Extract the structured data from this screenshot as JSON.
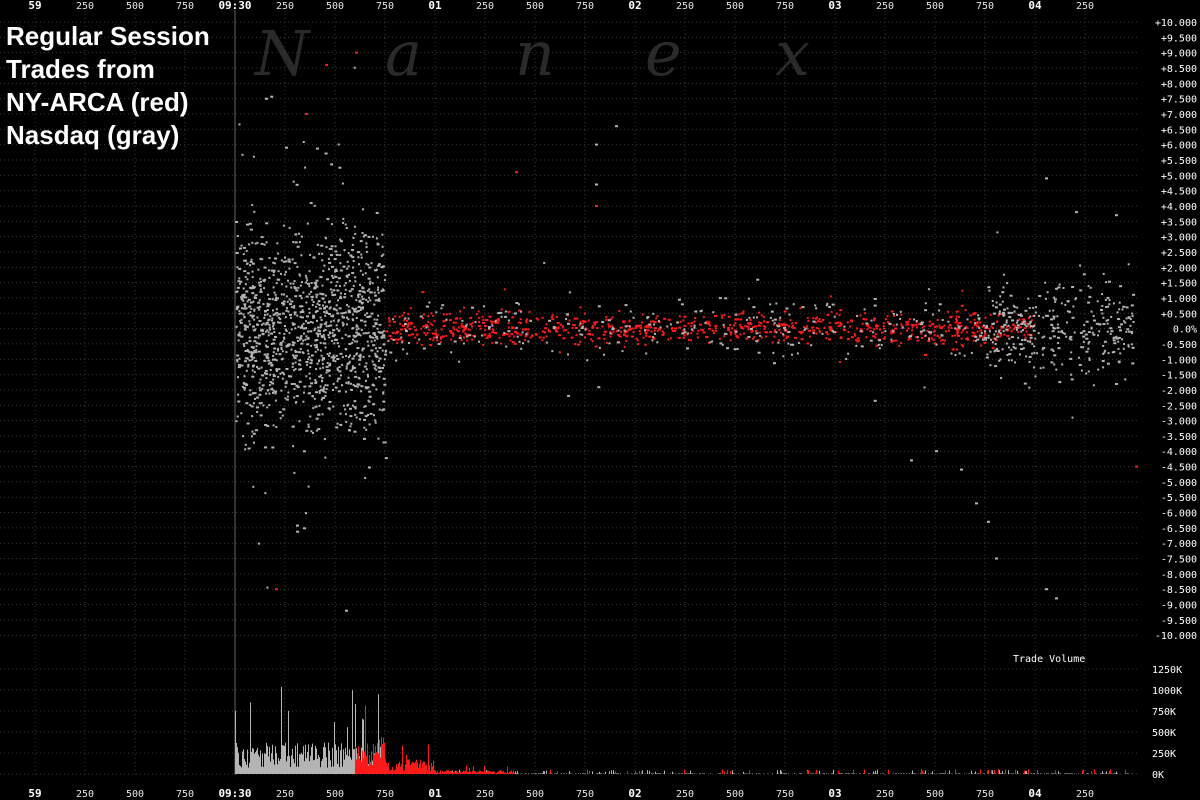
{
  "caption": {
    "lines": [
      "Regular Session",
      "Trades from",
      "NY-ARCA (red)",
      "Nasdaq (gray)"
    ]
  },
  "watermark": [
    "N",
    "a",
    "n",
    "e",
    "x"
  ],
  "volume_label": "Trade Volume",
  "colors": {
    "background": "#000000",
    "nyarca": "#ff1a1a",
    "nasdaq": "#b4b4b4",
    "grid": "#3a3a3a",
    "text": "#ffffff"
  },
  "chart_data": [
    {
      "type": "scatter",
      "title": "",
      "xlabel": "",
      "ylabel": "",
      "x_ticks": [
        {
          "label": "59",
          "major": true
        },
        {
          "label": "250",
          "major": false
        },
        {
          "label": "500",
          "major": false
        },
        {
          "label": "750",
          "major": false
        },
        {
          "label": "09:30",
          "major": true
        },
        {
          "label": "250",
          "major": false
        },
        {
          "label": "500",
          "major": false
        },
        {
          "label": "750",
          "major": false
        },
        {
          "label": "01",
          "major": true
        },
        {
          "label": "250",
          "major": false
        },
        {
          "label": "500",
          "major": false
        },
        {
          "label": "750",
          "major": false
        },
        {
          "label": "02",
          "major": true
        },
        {
          "label": "250",
          "major": false
        },
        {
          "label": "500",
          "major": false
        },
        {
          "label": "750",
          "major": false
        },
        {
          "label": "03",
          "major": true
        },
        {
          "label": "250",
          "major": false
        },
        {
          "label": "500",
          "major": false
        },
        {
          "label": "750",
          "major": false
        },
        {
          "label": "04",
          "major": true
        },
        {
          "label": "250",
          "major": false
        }
      ],
      "y_ticks": [
        "+10.000",
        "+9.500",
        "+9.000",
        "+8.500",
        "+8.000",
        "+7.500",
        "+7.000",
        "+6.500",
        "+6.000",
        "+5.500",
        "+5.000",
        "+4.500",
        "+4.000",
        "+3.500",
        "+3.000",
        "+2.500",
        "+2.000",
        "+1.500",
        "+1.000",
        "+0.500",
        "0.0%",
        "-0.500",
        "-1.000",
        "-1.500",
        "-2.000",
        "-2.500",
        "-3.000",
        "-3.500",
        "-4.000",
        "-4.500",
        "-5.000",
        "-5.500",
        "-6.000",
        "-6.500",
        "-7.000",
        "-7.500",
        "-8.000",
        "-8.500",
        "-9.000",
        "-9.500",
        "-10.000"
      ],
      "ylim": [
        -10,
        10
      ],
      "grid": true,
      "series": [
        {
          "name": "NY-ARCA",
          "color": "#ff1a1a"
        },
        {
          "name": "Nasdaq",
          "color": "#b4b4b4"
        }
      ],
      "regions": [
        {
          "series": "Nasdaq",
          "start": "09:30",
          "end": "09:30.750",
          "spread": 1.6,
          "density": "very high"
        },
        {
          "series": "NY-ARCA",
          "start": "09:30.750",
          "end": "09:34",
          "spread": 0.25,
          "density": "high"
        },
        {
          "series": "Nasdaq",
          "start": "09:30.750",
          "end": "09:34",
          "spread": 0.45,
          "density": "medium"
        },
        {
          "series": "Nasdaq",
          "start": "09:33.750",
          "end": "09:34.500",
          "spread": 0.8,
          "density": "medium"
        }
      ],
      "outliers": [
        {
          "series": "Nasdaq",
          "x": "09:33.375",
          "y": -4.3
        },
        {
          "series": "Nasdaq",
          "x": "09:33.500",
          "y": -4.0
        },
        {
          "series": "Nasdaq",
          "x": "09:33.625",
          "y": -4.6
        },
        {
          "series": "Nasdaq",
          "x": "09:33.700",
          "y": -5.7
        },
        {
          "series": "Nasdaq",
          "x": "09:33.760",
          "y": -6.3
        },
        {
          "series": "Nasdaq",
          "x": "09:33.800",
          "y": -7.5
        },
        {
          "series": "Nasdaq",
          "x": "09:34.050",
          "y": -8.5
        },
        {
          "series": "Nasdaq",
          "x": "09:34.100",
          "y": -8.8
        },
        {
          "series": "Nasdaq",
          "x": "09:34.050",
          "y": 4.9
        },
        {
          "series": "Nasdaq",
          "x": "09:34.200",
          "y": 3.8
        },
        {
          "series": "Nasdaq",
          "x": "09:34.400",
          "y": 3.7
        },
        {
          "series": "Nasdaq",
          "x": "09:31.800",
          "y": 6.0
        },
        {
          "series": "Nasdaq",
          "x": "09:31.900",
          "y": 6.6
        },
        {
          "series": "Nasdaq",
          "x": "09:31.800",
          "y": 4.7
        },
        {
          "series": "Nasdaq",
          "x": "09:30.150",
          "y": 7.5
        },
        {
          "series": "Nasdaq",
          "x": "09:30.250",
          "y": 5.9
        },
        {
          "series": "Nasdaq",
          "x": "09:30.550",
          "y": -9.2
        },
        {
          "series": "NY-ARCA",
          "x": "09:30.200",
          "y": -8.5
        },
        {
          "series": "NY-ARCA",
          "x": "09:30.450",
          "y": 8.6
        },
        {
          "series": "NY-ARCA",
          "x": "09:30.600",
          "y": 9.0
        },
        {
          "series": "NY-ARCA",
          "x": "09:30.350",
          "y": 7.0
        },
        {
          "series": "NY-ARCA",
          "x": "09:31.800",
          "y": 4.0
        },
        {
          "series": "NY-ARCA",
          "x": "09:31.400",
          "y": 5.1
        },
        {
          "series": "NY-ARCA",
          "x": "09:34.500",
          "y": -4.5
        }
      ]
    },
    {
      "type": "bar",
      "title": "Trade Volume",
      "y_ticks": [
        "1250K",
        "1000K",
        "750K",
        "500K",
        "250K",
        "0K"
      ],
      "ylim": [
        0,
        1250000
      ],
      "series": [
        {
          "name": "Nasdaq",
          "color": "#b4b4b4",
          "segments": [
            {
              "start": "09:30",
              "end": "09:30.750",
              "typical": 250000,
              "peak": 1050000
            },
            {
              "start": "09:30.750",
              "end": "09:34.500",
              "typical": 5000,
              "peak": 50000
            }
          ]
        },
        {
          "name": "NY-ARCA",
          "color": "#ff1a1a",
          "segments": [
            {
              "start": "09:30.600",
              "end": "09:30.750",
              "typical": 300000,
              "peak": 1350000
            },
            {
              "start": "09:30.750",
              "end": "09:31.000",
              "typical": 120000,
              "peak": 420000
            },
            {
              "start": "09:31.000",
              "end": "09:31.400",
              "typical": 30000,
              "peak": 120000
            },
            {
              "start": "09:31.400",
              "end": "09:34.500",
              "typical": 3000,
              "peak": 60000
            }
          ]
        }
      ]
    }
  ]
}
